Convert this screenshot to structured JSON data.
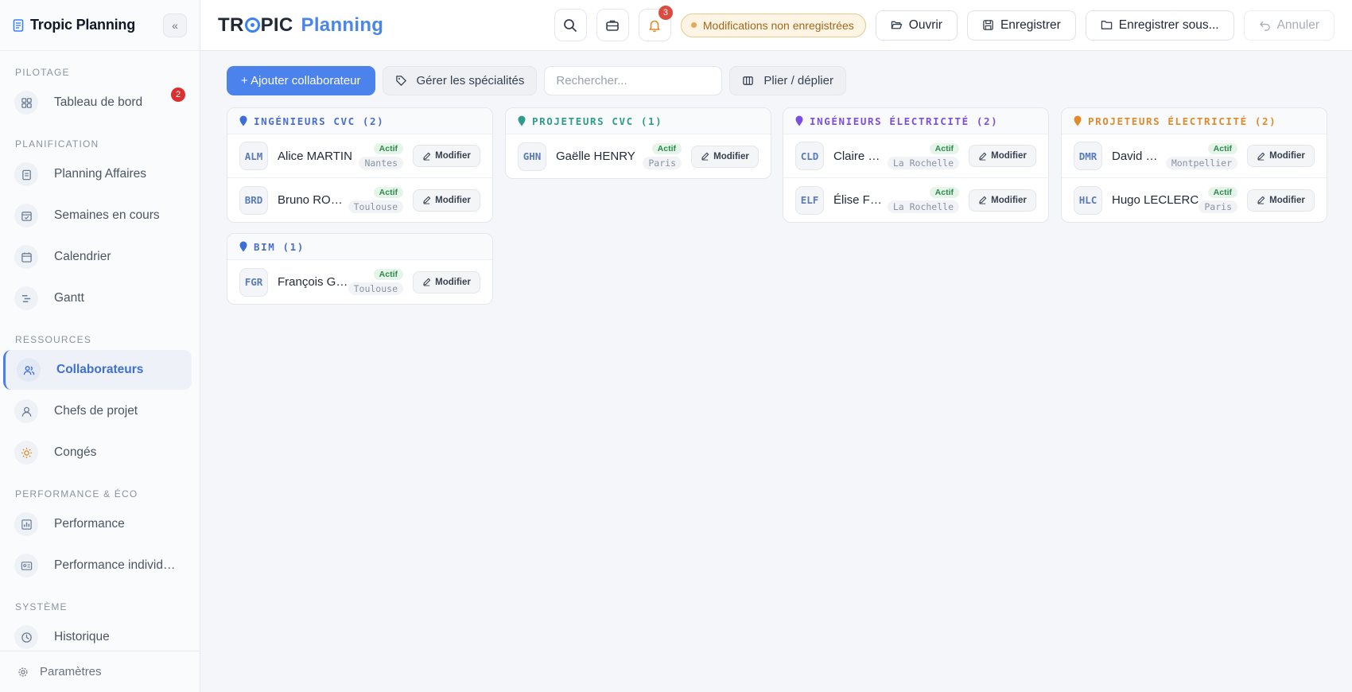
{
  "sidebar": {
    "title": "Tropic Planning",
    "sections": [
      {
        "label": "PILOTAGE",
        "items": [
          {
            "label": "Tableau de bord",
            "icon": "dashboard-icon",
            "badge": "2"
          }
        ]
      },
      {
        "label": "PLANIFICATION",
        "items": [
          {
            "label": "Planning Affaires",
            "icon": "clipboard-icon"
          },
          {
            "label": "Semaines en cours",
            "icon": "calendar-check-icon"
          },
          {
            "label": "Calendrier",
            "icon": "calendar-icon"
          },
          {
            "label": "Gantt",
            "icon": "gantt-icon"
          }
        ]
      },
      {
        "label": "RESSOURCES",
        "items": [
          {
            "label": "Collaborateurs",
            "icon": "users-icon",
            "active": true
          },
          {
            "label": "Chefs de projet",
            "icon": "user-icon"
          },
          {
            "label": "Congés",
            "icon": "sun-icon"
          }
        ]
      },
      {
        "label": "PERFORMANCE & ÉCO",
        "items": [
          {
            "label": "Performance",
            "icon": "bar-chart-icon"
          },
          {
            "label": "Performance individuelle",
            "icon": "id-card-icon"
          }
        ]
      },
      {
        "label": "SYSTÈME",
        "items": [
          {
            "label": "Historique",
            "icon": "history-icon"
          }
        ]
      }
    ],
    "footer": "Paramètres"
  },
  "topbar": {
    "brand_a": "TR",
    "brand_b": "PIC",
    "brand_c": "Planning",
    "notif_count": "3",
    "unsaved": "Modifications non enregistrées",
    "open": "Ouvrir",
    "save": "Enregistrer",
    "save_as": "Enregistrer sous...",
    "undo": "Annuler"
  },
  "toolbar": {
    "add": "+ Ajouter collaborateur",
    "specialties": "Gérer les spécialités",
    "search_placeholder": "Rechercher...",
    "fold": "Plier / déplier"
  },
  "colors": {
    "accent": "#4c82ec",
    "groups": [
      "#3b6fd8",
      "#2f9b8a",
      "#7b4fe0",
      "#e08a2c"
    ]
  },
  "groups": [
    {
      "title": "INGÉNIEURS CVC (2)",
      "color": "#4a6ed0",
      "pin": "#3b6fd8",
      "members": [
        {
          "initials": "ALM",
          "name": "Alice MARTIN",
          "status": "Actif",
          "city": "Nantes"
        },
        {
          "initials": "BRD",
          "name": "Bruno ROUSSEAU",
          "status": "Actif",
          "city": "Toulouse"
        }
      ]
    },
    {
      "title": "PROJETEURS CVC (1)",
      "color": "#2f9b8a",
      "pin": "#2f9b8a",
      "members": [
        {
          "initials": "GHN",
          "name": "Gaëlle HENRY",
          "status": "Actif",
          "city": "Paris"
        }
      ]
    },
    {
      "title": "INGÉNIEURS ÉLECTRICITÉ (2)",
      "color": "#7b4fe0",
      "pin": "#7b4fe0",
      "members": [
        {
          "initials": "CLD",
          "name": "Claire DUBOIS",
          "status": "Actif",
          "city": "La Rochelle"
        },
        {
          "initials": "ELF",
          "name": "Élise FONTAINE",
          "status": "Actif",
          "city": "La Rochelle"
        }
      ]
    },
    {
      "title": "PROJETEURS ÉLECTRICITÉ (2)",
      "color": "#e08a2c",
      "pin": "#e08a2c",
      "members": [
        {
          "initials": "DMR",
          "name": "David MOREAU",
          "status": "Actif",
          "city": "Montpellier"
        },
        {
          "initials": "HLC",
          "name": "Hugo LECLERC",
          "status": "Actif",
          "city": "Paris"
        }
      ]
    },
    {
      "title": "BIM (1)",
      "color": "#4a6ed0",
      "pin": "#3b6fd8",
      "members": [
        {
          "initials": "FGR",
          "name": "François GIRARD",
          "status": "Actif",
          "city": "Toulouse"
        }
      ]
    }
  ],
  "modify_label": "Modifier"
}
